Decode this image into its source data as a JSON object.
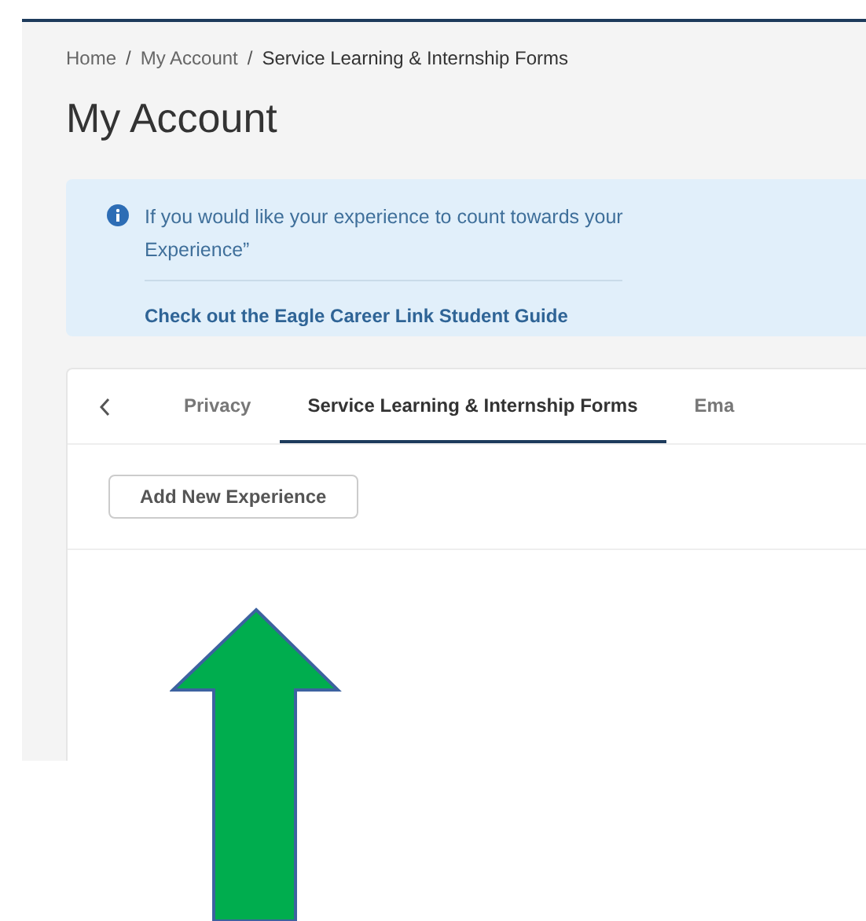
{
  "breadcrumb": [
    {
      "label": "Home",
      "current": false
    },
    {
      "label": "My Account",
      "current": false
    },
    {
      "label": "Service Learning & Internship Forms",
      "current": true
    }
  ],
  "breadcrumb_separator": "/",
  "title": "My Account",
  "info": {
    "message": "If you would like your experience to count towards your",
    "message_line_2": "Experience”",
    "link": "Check out  the Eagle Career Link Student Guide"
  },
  "tabs": [
    {
      "label": "Privacy",
      "selected": false
    },
    {
      "label": "Service Learning & Internship Forms",
      "selected": true
    },
    {
      "label": "Ema",
      "selected": false
    }
  ],
  "add_button": "Add New Experience"
}
